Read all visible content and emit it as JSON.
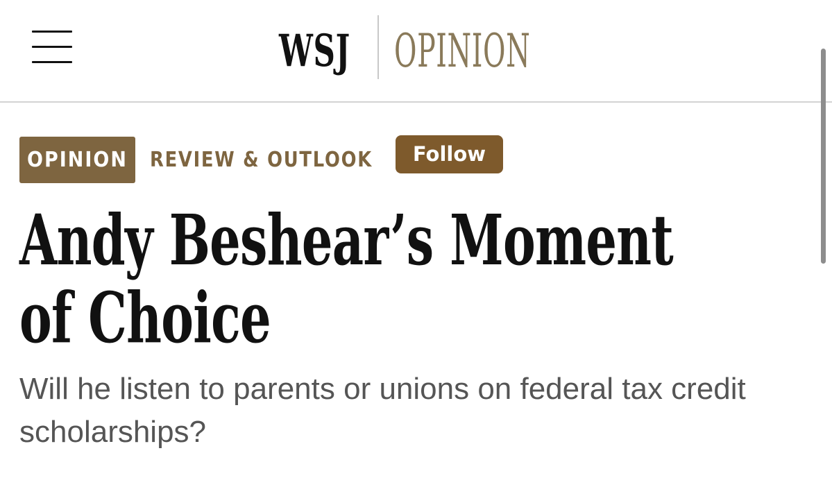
{
  "header": {
    "menu_icon": "hamburger-menu-icon",
    "logo": {
      "brand": "WSJ",
      "section": "OPINION",
      "brand_color": "#111111",
      "section_color": "#8a7a5a"
    }
  },
  "article": {
    "section_tag": "OPINION",
    "section_name": "REVIEW & OUTLOOK",
    "follow_label": "Follow",
    "headline": "Andy Beshear’s Moment of Choice",
    "dek": "Will he listen to parents or unions on federal tax credit scholarships?",
    "accent_color": "#7e6540"
  }
}
